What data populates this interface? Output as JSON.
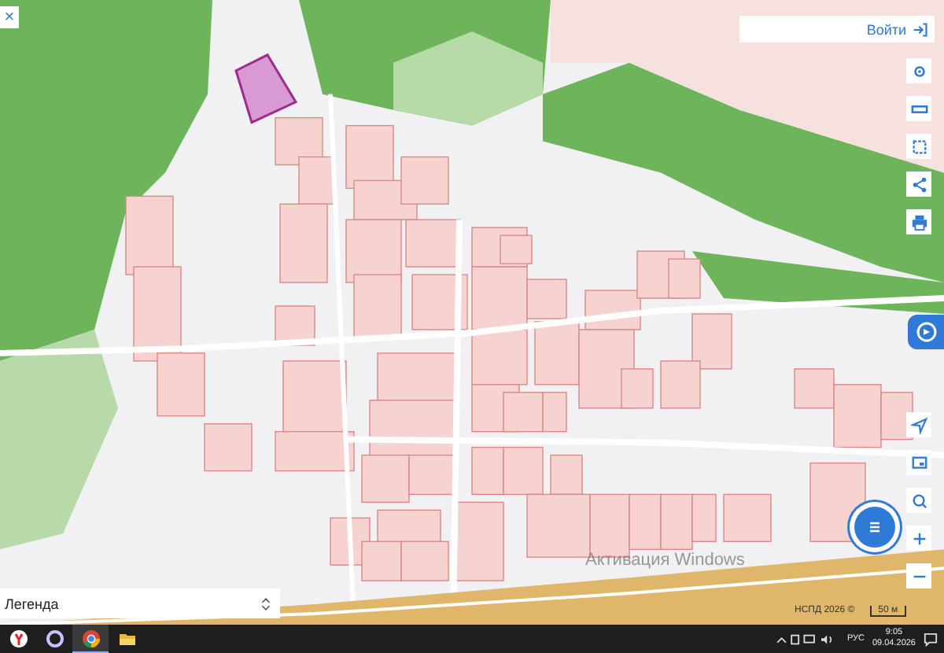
{
  "close_button": {
    "label": "×"
  },
  "login_button": {
    "label": "Войти"
  },
  "legend_panel": {
    "label": "Легенда"
  },
  "os_watermark": {
    "title": "Активация Windows"
  },
  "attribution": {
    "text": "НСПД 2026 ©",
    "scale": "50 м"
  },
  "taskbar": {
    "apps": [
      {
        "kind": "yandex",
        "selected": false
      },
      {
        "kind": "ring",
        "selected": false
      },
      {
        "kind": "chrome",
        "selected": true
      },
      {
        "kind": "folder",
        "selected": false
      }
    ],
    "language": "РУС",
    "time": "9:05",
    "date": "09.04.2026"
  }
}
